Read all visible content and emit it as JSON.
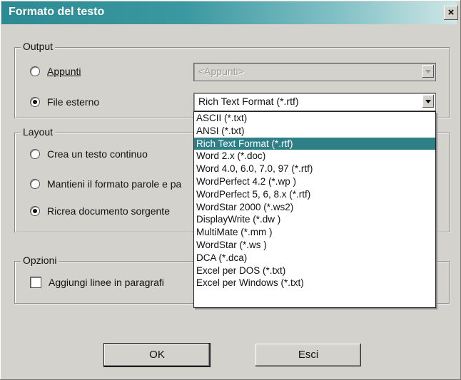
{
  "window": {
    "title": "Formato del testo",
    "close_label": "×"
  },
  "output": {
    "label": "Output",
    "option_appunti": "Appunti",
    "option_file": "File esterno",
    "appunti_value": "<Appunti>",
    "file_format_value": "Rich Text Format (*.rtf)"
  },
  "layout": {
    "label": "Layout",
    "option_continuo": "Crea un testo continuo",
    "option_mantieni": "Mantieni il formato parole e pa",
    "option_ricrea": "Ricrea documento sorgente"
  },
  "opzioni": {
    "label": "Opzioni",
    "checkbox_label": "Aggiungi linee in paragrafi"
  },
  "dropdown_items": [
    "ASCII (*.txt)",
    "ANSI (*.txt)",
    "Rich Text Format (*.rtf)",
    "Word 2.x (*.doc)",
    "Word 4.0, 6.0, 7.0, 97 (*.rtf)",
    "WordPerfect 4.2 (*.wp )",
    "WordPerfect 5, 6, 8.x (*.rtf)",
    "WordStar 2000 (*.ws2)",
    "DisplayWrite (*.dw )",
    "MultiMate (*.mm )",
    "WordStar (*.ws )",
    "DCA (*.dca)",
    "Excel per DOS (*.txt)",
    "Excel per Windows (*.txt)"
  ],
  "selected_index": 2,
  "buttons": {
    "ok": "OK",
    "cancel": "Esci"
  }
}
